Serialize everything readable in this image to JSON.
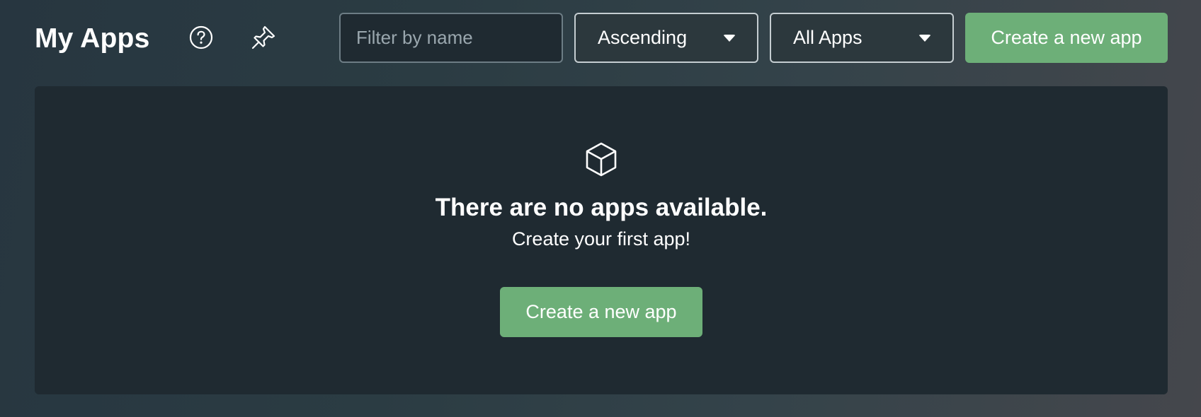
{
  "header": {
    "title": "My Apps",
    "icons": [
      "help-circle-icon",
      "pin-icon"
    ],
    "filter": {
      "placeholder": "Filter by name",
      "value": ""
    },
    "sort_select": {
      "selected": "Ascending"
    },
    "scope_select": {
      "selected": "All Apps"
    },
    "create_label": "Create a new app"
  },
  "empty_state": {
    "icon": "cube-icon",
    "title": "There are no apps available.",
    "subtitle": "Create your first app!",
    "create_label": "Create a new app"
  },
  "colors": {
    "accent": "#6daf78",
    "panel": "#1f2a31",
    "background": "#2b3c43"
  }
}
